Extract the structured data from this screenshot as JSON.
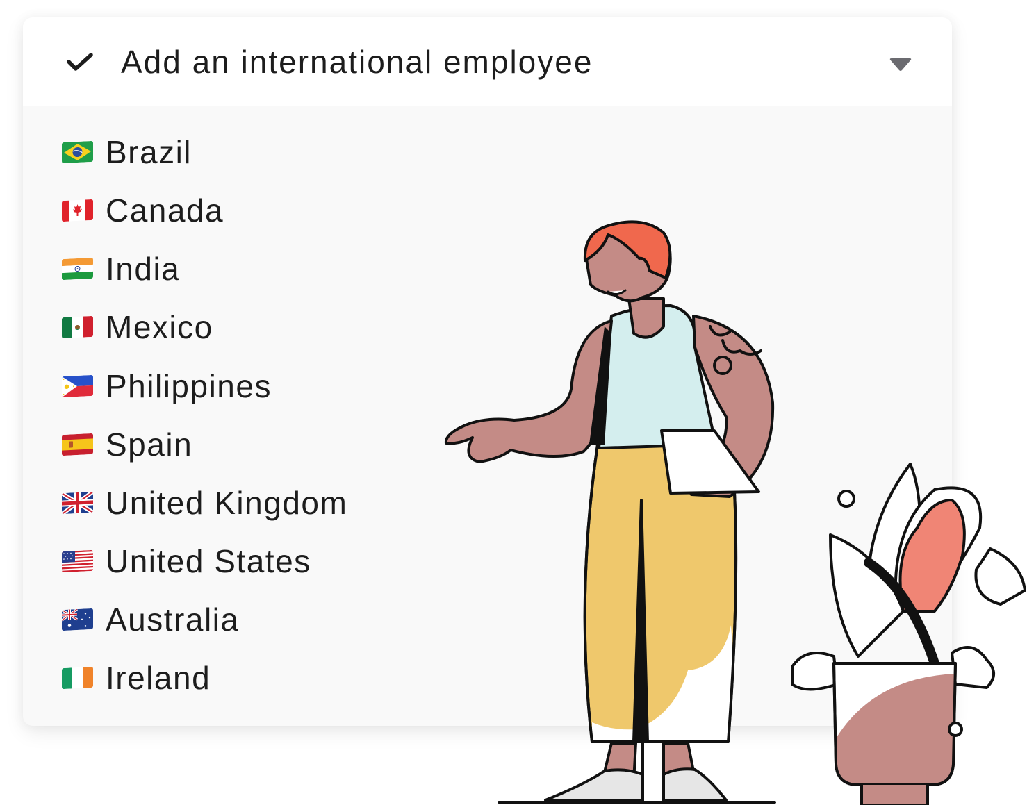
{
  "dropdown": {
    "selected_label": "Add an international employee",
    "check_icon": "check-icon",
    "caret_icon": "caret-down-icon",
    "options": [
      {
        "label": "Brazil",
        "flag": "flag-brazil-icon"
      },
      {
        "label": "Canada",
        "flag": "flag-canada-icon"
      },
      {
        "label": "India",
        "flag": "flag-india-icon"
      },
      {
        "label": "Mexico",
        "flag": "flag-mexico-icon"
      },
      {
        "label": "Philippines",
        "flag": "flag-philippines-icon"
      },
      {
        "label": "Spain",
        "flag": "flag-spain-icon"
      },
      {
        "label": "United Kingdom",
        "flag": "flag-uk-icon"
      },
      {
        "label": "United States",
        "flag": "flag-us-icon"
      },
      {
        "label": "Australia",
        "flag": "flag-australia-icon"
      },
      {
        "label": "Ireland",
        "flag": "flag-ireland-icon"
      }
    ]
  },
  "colors": {
    "text": "#1d1d1d",
    "caret": "#6b6b70",
    "header_bg": "#ffffff",
    "list_bg": "#f9f9f9",
    "skin": "#c48b86",
    "hair": "#f0684d",
    "shirt": "#d4eeee",
    "pants": "#efc86c",
    "leaf_accent": "#f08575"
  }
}
